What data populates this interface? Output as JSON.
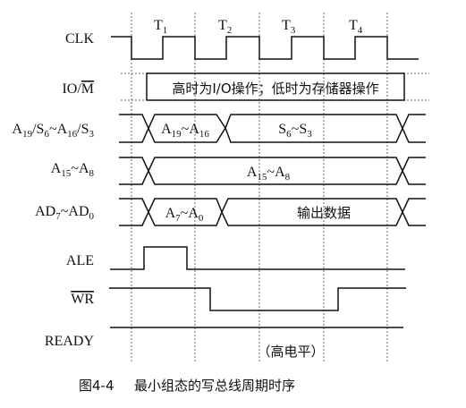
{
  "title": "最小组态的写总线周期时序",
  "figure_number": "图4-4",
  "states": [
    {
      "t": "T",
      "n": "1"
    },
    {
      "t": "T",
      "n": "2"
    },
    {
      "t": "T",
      "n": "3"
    },
    {
      "t": "T",
      "n": "4"
    }
  ],
  "signals": {
    "clk": "CLK",
    "iom": {
      "io": "IO/",
      "m": "M"
    },
    "a19": [
      "A",
      "19",
      "/S",
      "6",
      "~A",
      "16",
      "/S",
      "3"
    ],
    "a15": [
      "A",
      "15",
      "~A",
      "8"
    ],
    "ad": [
      "AD",
      "7",
      "~AD",
      "0"
    ],
    "ale": "ALE",
    "wr": "WR",
    "ready": "READY"
  },
  "annotations": {
    "iom_note": "高时为I/O操作；低时为存储器操作",
    "a19_addr": [
      "A",
      "19",
      "~A",
      "16"
    ],
    "a19_status": [
      "S",
      "6",
      "~S",
      "3"
    ],
    "a15_value": [
      "A",
      "15",
      "~A",
      "8"
    ],
    "ad_addr": [
      "A",
      "7",
      "~A",
      "0"
    ],
    "ad_data": "输出数据",
    "ready_note": "（高电平）"
  }
}
